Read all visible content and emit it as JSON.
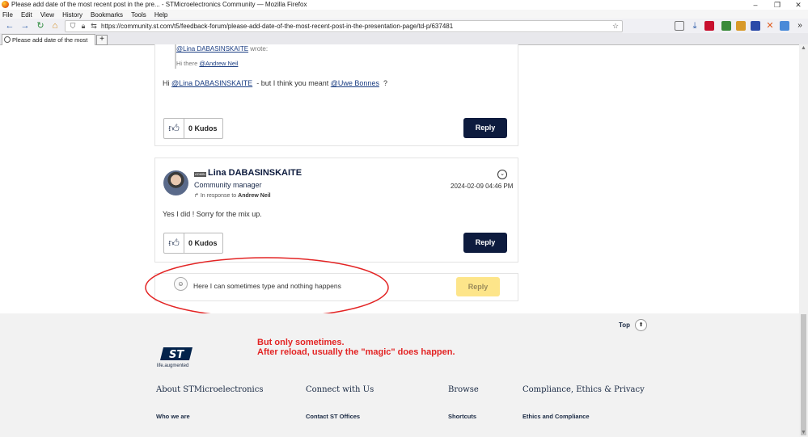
{
  "window": {
    "title": "Please add date of the most recent post in the pre... - STMicroelectronics Community — Mozilla Firefox"
  },
  "menu": [
    "File",
    "Edit",
    "View",
    "History",
    "Bookmarks",
    "Tools",
    "Help"
  ],
  "nav": {
    "url": "https://community.st.com/t5/feedback-forum/please-add-date-of-the-most-recent-post-in-the-presentation-page/td-p/637481"
  },
  "tab": {
    "title": "Please add date of the most recen",
    "new_tab_label": "+"
  },
  "post1": {
    "quote_author": "@Lina DABASINSKAITE",
    "quote_wrote": "wrote:",
    "quote_greeting": "Hi there",
    "quote_mention": "@Andrew Neil",
    "body_prefix": "Hi",
    "body_mention1": "@Lina DABASINSKAITE",
    "body_middle": "- but I think you meant",
    "body_mention2": "@Uwe Bonnes",
    "body_suffix": "?",
    "kudos": "0 Kudos",
    "reply": "Reply"
  },
  "post2": {
    "badge": "ADMIN",
    "author": "Lina DABASINSKAITE",
    "role": "Community manager",
    "in_response_prefix": "In response to",
    "in_response_to": "Andrew Neil",
    "timestamp": "2024-02-09 04:46 PM",
    "body": "Yes I did ! Sorry for the mix up.",
    "kudos": "0 Kudos",
    "reply": "Reply"
  },
  "quick_reply": {
    "placeholder": "Here I can sometimes type and nothing happens",
    "button": "Reply"
  },
  "annotation": {
    "line1": "But only sometimes.",
    "line2": "After reload, usually the \"magic\" does happen.",
    "color": "#e32424"
  },
  "footer": {
    "top_label": "Top",
    "logo_tagline": "life.augmented",
    "columns": [
      {
        "heading": "About STMicroelectronics",
        "link": "Who we are"
      },
      {
        "heading": "Connect with Us",
        "link": "Contact ST Offices"
      },
      {
        "heading": "Browse",
        "link": "Shortcuts"
      },
      {
        "heading": "Compliance, Ethics & Privacy",
        "link": "Ethics and Compliance"
      }
    ]
  },
  "colors": {
    "reply_button": "#0d1b3e",
    "reply_disabled": "#fde58a",
    "link": "#1a3d82"
  }
}
